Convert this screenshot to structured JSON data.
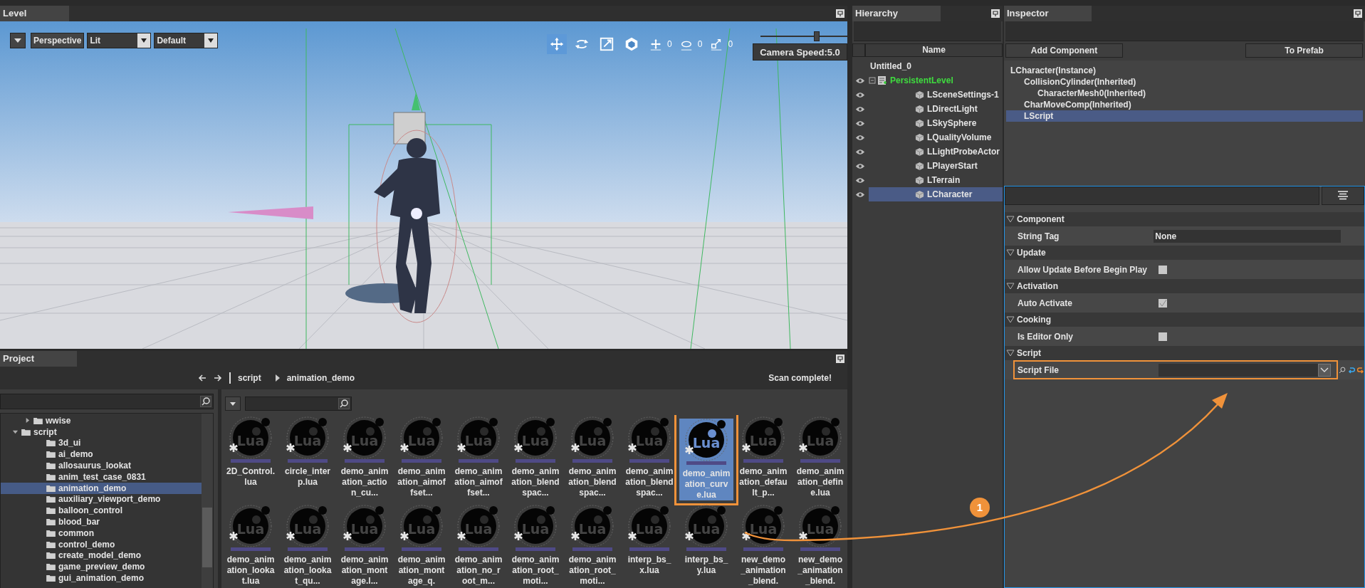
{
  "level": {
    "tab": "Level",
    "view_mode": "Perspective",
    "lighting": "Lit",
    "preset": "Default",
    "gizmos": [
      {
        "kind": "move",
        "selected": true
      },
      {
        "kind": "rotate",
        "selected": false
      },
      {
        "kind": "scale",
        "selected": false
      },
      {
        "kind": "world",
        "selected": false
      }
    ],
    "snaps": [
      {
        "kind": "move",
        "value": "0"
      },
      {
        "kind": "rotate",
        "value": "0"
      },
      {
        "kind": "scale",
        "value": "0"
      }
    ],
    "camera_speed": {
      "level": 0.56,
      "label": "Camera Speed:5.0"
    }
  },
  "hierarchy": {
    "tab": "Hierarchy",
    "column": "Name",
    "tree": [
      {
        "label": "Untitled_0",
        "kind": "scene",
        "selected": false,
        "children": [
          {
            "label": "PersistentLevel",
            "kind": "level",
            "selected": false,
            "children": [
              {
                "label": "LSceneSettings-1",
                "kind": "actor",
                "selected": false
              },
              {
                "label": "LDirectLight",
                "kind": "actor",
                "selected": false
              },
              {
                "label": "LSkySphere",
                "kind": "actor",
                "selected": false
              },
              {
                "label": "LQualityVolume",
                "kind": "actor",
                "selected": false
              },
              {
                "label": "LLightProbeActor",
                "kind": "actor",
                "selected": false
              },
              {
                "label": "LPlayerStart",
                "kind": "actor",
                "selected": false
              },
              {
                "label": "LTerrain",
                "kind": "actor",
                "selected": false
              },
              {
                "label": "LCharacter",
                "kind": "actor",
                "selected": true
              }
            ]
          }
        ]
      }
    ]
  },
  "inspector": {
    "tab": "Inspector",
    "buttons": [
      "Add Component",
      "To Prefab"
    ],
    "components": [
      {
        "label": "LCharacter(Instance)",
        "selected": false,
        "children": [
          {
            "label": "CollisionCylinder(Inherited)",
            "selected": false,
            "children": [
              {
                "label": "CharacterMesh0(Inherited)",
                "selected": false
              }
            ]
          },
          {
            "label": "CharMoveComp(Inherited)",
            "selected": false
          },
          {
            "label": "LScript",
            "selected": true
          }
        ]
      }
    ],
    "sections": [
      {
        "title": "Component",
        "properties": [
          {
            "kind": "text",
            "label": "String Tag",
            "value": "None"
          }
        ]
      },
      {
        "title": "Update",
        "properties": [
          {
            "kind": "checkbox",
            "label": "Allow Update Before Begin Play",
            "checked": false
          }
        ]
      },
      {
        "title": "Activation",
        "properties": [
          {
            "kind": "checkbox",
            "label": "Auto Activate",
            "checked": true
          }
        ]
      },
      {
        "title": "Cooking",
        "properties": [
          {
            "kind": "checkbox",
            "label": "Is Editor Only",
            "checked": false
          }
        ]
      },
      {
        "title": "Script",
        "properties": [
          {
            "kind": "dropdown",
            "label": "Script File",
            "highlighted": true
          }
        ]
      }
    ]
  },
  "project": {
    "tab": "Project",
    "breadcrumb": [
      "script",
      "animation_demo"
    ],
    "status": "Scan complete!",
    "folders": [
      {
        "label": "wwise",
        "expanded": false,
        "selected": false
      },
      {
        "label": "script",
        "expanded": true,
        "selected": false,
        "children": [
          {
            "label": "3d_ui",
            "selected": false
          },
          {
            "label": "ai_demo",
            "selected": false
          },
          {
            "label": "allosaurus_lookat",
            "selected": false
          },
          {
            "label": "anim_test_case_0831",
            "selected": false
          },
          {
            "label": "animation_demo",
            "selected": true
          },
          {
            "label": "auxiliary_viewport_demo",
            "selected": false
          },
          {
            "label": "balloon_control",
            "selected": false
          },
          {
            "label": "blood_bar",
            "selected": false
          },
          {
            "label": "common",
            "selected": false
          },
          {
            "label": "control_demo",
            "selected": false
          },
          {
            "label": "create_model_demo",
            "selected": false
          },
          {
            "label": "game_preview_demo",
            "selected": false
          },
          {
            "label": "gui_animation_demo",
            "selected": false
          }
        ]
      }
    ],
    "files": [
      {
        "name": "2D_Control.lua",
        "icon_text": "Lua",
        "selected": false
      },
      {
        "name": "circle_interp.lua",
        "icon_text": "Lua",
        "selected": false
      },
      {
        "name": "demo_animation_action_cu...",
        "icon_text": "Lua",
        "selected": false
      },
      {
        "name": "demo_animation_aimoffset...",
        "icon_text": "Lua",
        "selected": false
      },
      {
        "name": "demo_animation_aimoffset...",
        "icon_text": "Lua",
        "selected": false
      },
      {
        "name": "demo_animation_blendspac...",
        "icon_text": "Lua",
        "selected": false
      },
      {
        "name": "demo_animation_blendspac...",
        "icon_text": "Lua",
        "selected": false
      },
      {
        "name": "demo_animation_blendspac...",
        "icon_text": "Lua",
        "selected": false
      },
      {
        "name": "demo_animation_curve.lua",
        "icon_text": "Lua",
        "selected": true
      },
      {
        "name": "demo_animation_default_p...",
        "icon_text": "Lua",
        "selected": false
      },
      {
        "name": "demo_animation_define.lua",
        "icon_text": "Lua",
        "selected": false
      },
      {
        "name": "demo_animation_lookat.lua",
        "icon_text": "Lua",
        "selected": false
      },
      {
        "name": "demo_animation_lookat_qu...",
        "icon_text": "Lua",
        "selected": false
      },
      {
        "name": "demo_animation_montage.l...",
        "icon_text": "Lua",
        "selected": false
      },
      {
        "name": "demo_animation_montage_q.",
        "icon_text": "Lua",
        "selected": false
      },
      {
        "name": "demo_animation_no_root_m...",
        "icon_text": "Lua",
        "selected": false
      },
      {
        "name": "demo_animation_root_moti...",
        "icon_text": "Lua",
        "selected": false
      },
      {
        "name": "demo_animation_root_moti...",
        "icon_text": "Lua",
        "selected": false
      },
      {
        "name": "interp_bs_x.lua",
        "icon_text": "Lua",
        "selected": false
      },
      {
        "name": "interp_bs_y.lua",
        "icon_text": "Lua",
        "selected": false
      },
      {
        "name": "new_demo_animation_blend.",
        "icon_text": "Lua",
        "selected": false
      },
      {
        "name": "new_demo_animation_blend.",
        "icon_text": "Lua",
        "selected": false
      }
    ]
  },
  "annotation": {
    "badge": "1"
  }
}
